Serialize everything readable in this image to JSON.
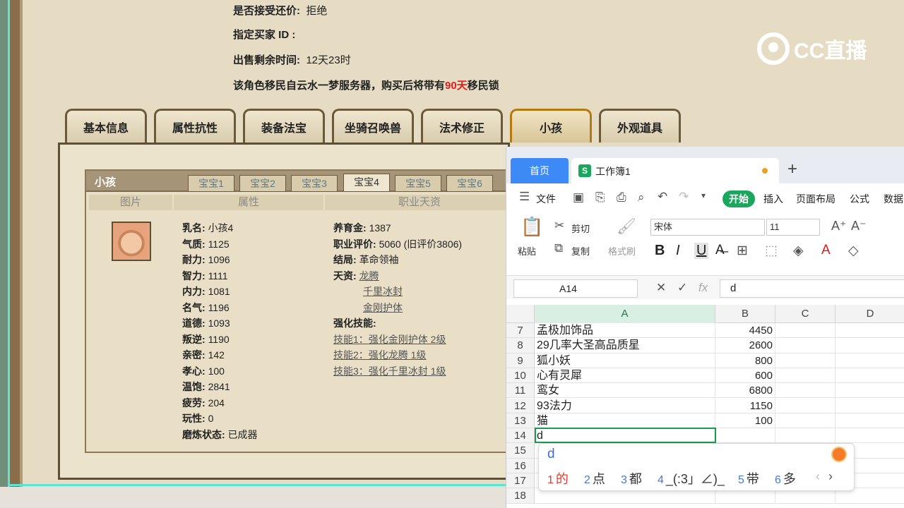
{
  "listing": {
    "accept_counter_label": "是否接受还价:",
    "accept_counter_value": "拒绝",
    "buyer_id_label": "指定买家 ID :",
    "remaining_label": "出售剩余时间:",
    "remaining_value": "12天23时",
    "migrate_prefix": "该角色移民自云水一梦服务器，购买后将带有",
    "migrate_days": "90天",
    "migrate_suffix": "移民锁"
  },
  "logo": {
    "text": "CC直播"
  },
  "tabs": [
    "基本信息",
    "属性抗性",
    "装备法宝",
    "坐骑召唤兽",
    "法术修正",
    "小孩",
    "外观道具"
  ],
  "active_tab": "小孩",
  "child_panel": {
    "title": "小孩",
    "baby_tabs": [
      "宝宝1",
      "宝宝2",
      "宝宝3",
      "宝宝4",
      "宝宝5",
      "宝宝6"
    ],
    "active_baby_tab": "宝宝4",
    "col_headers": [
      "图片",
      "属性",
      "职业天资"
    ],
    "attributes": [
      {
        "label": "乳名:",
        "value": "小孩4"
      },
      {
        "label": "气质:",
        "value": "1125"
      },
      {
        "label": "耐力:",
        "value": "1096"
      },
      {
        "label": "智力:",
        "value": "1111"
      },
      {
        "label": "内力:",
        "value": "1081"
      },
      {
        "label": "名气:",
        "value": "1196"
      },
      {
        "label": "道德:",
        "value": "1093"
      },
      {
        "label": "叛逆:",
        "value": "1190"
      },
      {
        "label": "亲密:",
        "value": "142"
      },
      {
        "label": "孝心:",
        "value": "100"
      },
      {
        "label": "温饱:",
        "value": "2841"
      },
      {
        "label": "疲劳:",
        "value": "204"
      },
      {
        "label": "玩性:",
        "value": "0"
      },
      {
        "label": "磨炼状态:",
        "value": "已成器"
      }
    ],
    "career": {
      "funds_label": "养育金:",
      "funds_value": "1387",
      "rating_label": "职业评价:",
      "rating_value": "5060 (旧评价3806)",
      "ending_label": "结局:",
      "ending_value": "革命领袖",
      "talent_label": "天资:",
      "talents": [
        "龙腾",
        "千里冰封",
        "金刚护体"
      ],
      "skills_label": "强化技能:",
      "skills": [
        "技能1：强化金刚护体 2级",
        "技能2：强化龙腾 1级",
        "技能3：强化千里冰封 1级"
      ]
    }
  },
  "wps": {
    "home_tab": "首页",
    "doc_icon": "S",
    "doc_name": "工作簿1",
    "menu": {
      "file": "文件",
      "start": "开始",
      "insert": "插入",
      "layout": "页面布局",
      "formula": "公式",
      "data": "数据"
    },
    "toolbar": {
      "paste": "粘贴",
      "cut": "剪切",
      "copy": "复制",
      "format_painter": "格式刷",
      "font_name": "宋体",
      "font_size": "11"
    },
    "name_box": "A14",
    "formula_value": "d",
    "columns": [
      "A",
      "B",
      "C",
      "D"
    ],
    "rows": [
      {
        "num": "7",
        "a": "孟极加饰品",
        "b": "4450"
      },
      {
        "num": "8",
        "a": "29几率大圣高品质星",
        "b": "2600"
      },
      {
        "num": "9",
        "a": "狐小妖",
        "b": "800"
      },
      {
        "num": "10",
        "a": "心有灵犀",
        "b": "600"
      },
      {
        "num": "11",
        "a": "鸾女",
        "b": "6800"
      },
      {
        "num": "12",
        "a": "93法力",
        "b": "1150"
      },
      {
        "num": "13",
        "a": "猫",
        "b": "100"
      },
      {
        "num": "14",
        "a": "d",
        "b": ""
      },
      {
        "num": "15",
        "a": "",
        "b": ""
      },
      {
        "num": "16",
        "a": "",
        "b": ""
      },
      {
        "num": "17",
        "a": "",
        "b": ""
      },
      {
        "num": "18",
        "a": "",
        "b": ""
      }
    ]
  },
  "ime": {
    "input": "d",
    "candidates": [
      {
        "n": "1",
        "text": "的"
      },
      {
        "n": "2",
        "text": "点"
      },
      {
        "n": "3",
        "text": "都"
      },
      {
        "n": "4",
        "text": "_(:3」∠)_"
      },
      {
        "n": "5",
        "text": "带"
      },
      {
        "n": "6",
        "text": "多"
      }
    ]
  },
  "colors": {
    "accent_red": "#e31b1b",
    "wps_blue": "#3d8af7",
    "wps_green": "#1aa65c",
    "overlay_cyan": "#5fe3d2"
  }
}
